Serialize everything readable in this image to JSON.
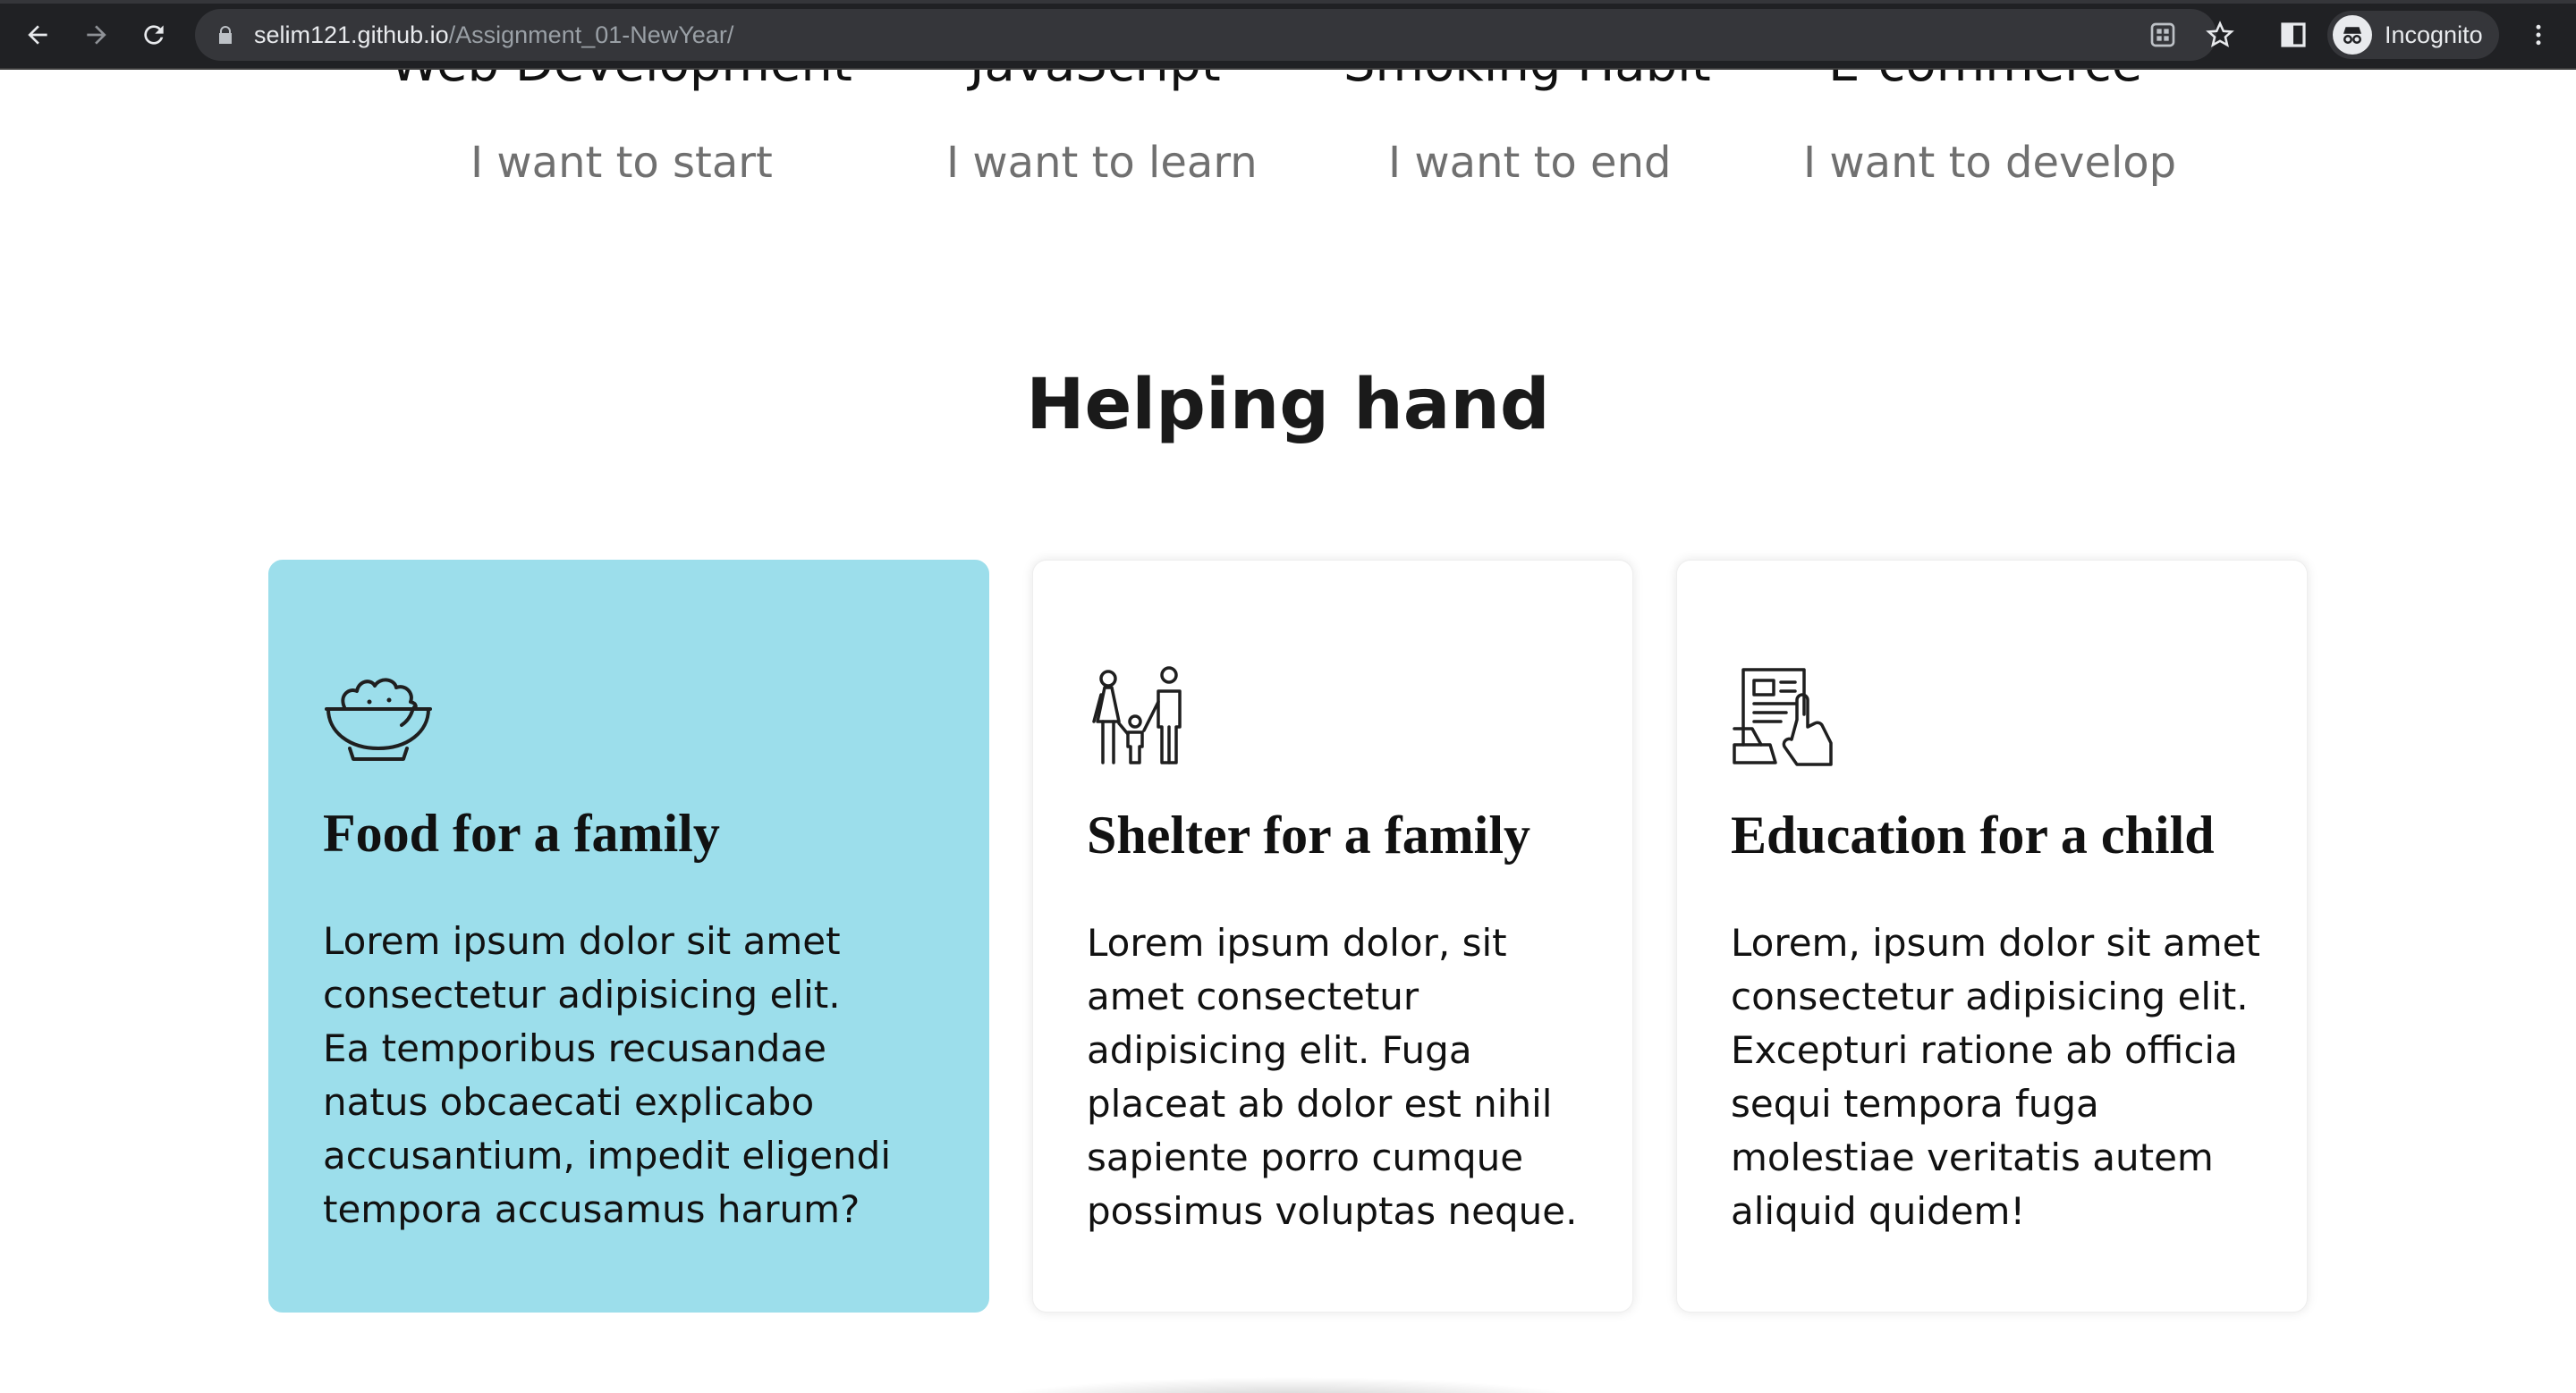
{
  "browser": {
    "url_host": "selim121.github.io",
    "url_path": "/Assignment_01-NewYear/",
    "profile_label": "Incognito"
  },
  "goals": [
    {
      "title": "Web Development",
      "subtitle": "I want to start"
    },
    {
      "title": "JavaScript",
      "subtitle": "I want to learn"
    },
    {
      "title": "Smoking Habit",
      "subtitle": "I want to end"
    },
    {
      "title": "E-commerce",
      "subtitle": "I want to develop"
    }
  ],
  "helping": {
    "title": "Helping hand",
    "cards": [
      {
        "icon": "food-bowl-icon",
        "title": "Food for a family",
        "body": "Lorem ipsum dolor sit amet consectetur adipisicing elit. Ea temporibus recusandae natus obcaecati explicabo accusantium, impedit eligendi tempora accusamus harum?",
        "highlighted": true
      },
      {
        "icon": "family-icon",
        "title": "Shelter for a family",
        "body": "Lorem ipsum dolor, sit amet consectetur adipisicing elit. Fuga placeat ab dolor est nihil sapiente porro cumque possimus voluptas neque.",
        "highlighted": false
      },
      {
        "icon": "newspaper-hand-icon",
        "title": "Education for a child",
        "body": "Lorem, ipsum dolor sit amet consectetur adipisicing elit. Excepturi ratione ab officia sequi tempora fuga molestiae veritatis autem aliquid quidem!",
        "highlighted": false
      }
    ]
  },
  "colors": {
    "highlight_card": "#9cdeeb",
    "chrome_bg": "#202124"
  }
}
